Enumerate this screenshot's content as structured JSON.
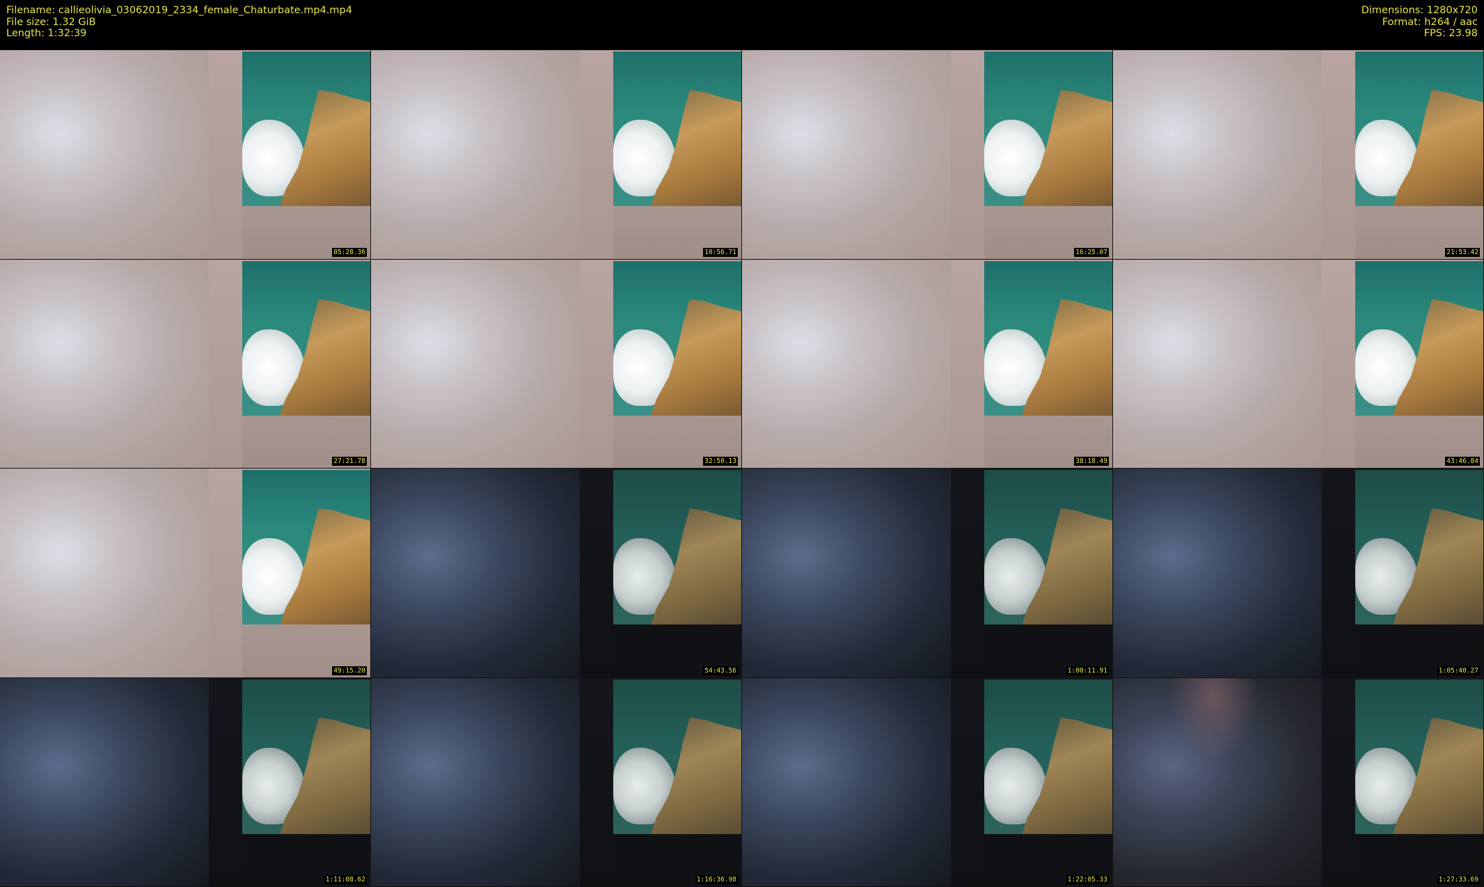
{
  "header": {
    "filename": "Filename: callieolivia_03062019_2334_female_Chaturbate.mp4.mp4",
    "file_size": "File size: 1.32 GiB",
    "length": "Length: 1:32:39",
    "dimensions": "Dimensions: 1280x720",
    "format": "Format: h264 / aac",
    "fps": "FPS: 23.98"
  },
  "colors": {
    "label_text": "#e6e64c",
    "background": "#000000"
  },
  "thumbnails": [
    {
      "timestamp": "05:28.36",
      "scene": "bright"
    },
    {
      "timestamp": "10:56.71",
      "scene": "bright"
    },
    {
      "timestamp": "16:25.07",
      "scene": "bright"
    },
    {
      "timestamp": "21:53.42",
      "scene": "bright"
    },
    {
      "timestamp": "27:21.78",
      "scene": "bright"
    },
    {
      "timestamp": "32:50.13",
      "scene": "bright"
    },
    {
      "timestamp": "38:18.49",
      "scene": "bright"
    },
    {
      "timestamp": "43:46.84",
      "scene": "bright"
    },
    {
      "timestamp": "49:15.20",
      "scene": "bright"
    },
    {
      "timestamp": "54:43.56",
      "scene": "dark"
    },
    {
      "timestamp": "1:00:11.91",
      "scene": "dark"
    },
    {
      "timestamp": "1:05:40.27",
      "scene": "dark"
    },
    {
      "timestamp": "1:11:08.62",
      "scene": "dark"
    },
    {
      "timestamp": "1:16:36.98",
      "scene": "dark"
    },
    {
      "timestamp": "1:22:05.33",
      "scene": "dark"
    },
    {
      "timestamp": "1:27:33.69",
      "scene": "pinkish"
    }
  ]
}
